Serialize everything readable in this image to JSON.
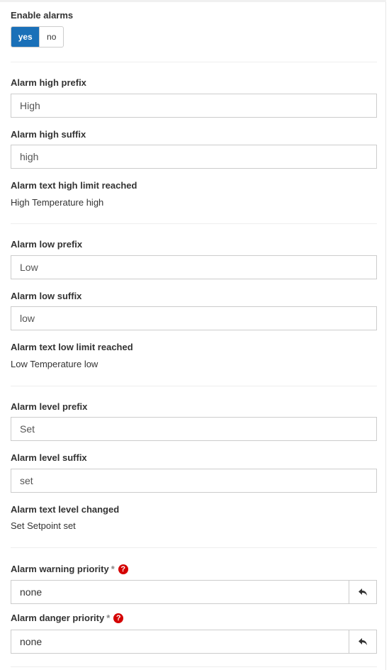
{
  "enable_alarms": {
    "label": "Enable alarms",
    "yes_label": "yes",
    "no_label": "no",
    "selected": "yes",
    "active_color": "#1a70b8"
  },
  "high": {
    "prefix_label": "Alarm high prefix",
    "prefix_value": "High",
    "suffix_label": "Alarm high suffix",
    "suffix_value": "high",
    "text_label": "Alarm text high limit reached",
    "text_value": "High Temperature high"
  },
  "low": {
    "prefix_label": "Alarm low prefix",
    "prefix_value": "Low",
    "suffix_label": "Alarm low suffix",
    "suffix_value": "low",
    "text_label": "Alarm text low limit reached",
    "text_value": "Low Temperature low"
  },
  "level": {
    "prefix_label": "Alarm level prefix",
    "prefix_value": "Set",
    "suffix_label": "Alarm level suffix",
    "suffix_value": "set",
    "text_label": "Alarm text level changed",
    "text_value": "Set Setpoint set"
  },
  "warning_priority": {
    "label": "Alarm warning priority",
    "required_mark": "*",
    "help_icon": "question-circle-icon",
    "value": "none",
    "reset_icon": "undo-arrow-icon"
  },
  "danger_priority": {
    "label": "Alarm danger priority",
    "required_mark": "*",
    "help_icon": "question-circle-icon",
    "value": "none",
    "reset_icon": "undo-arrow-icon"
  },
  "colors": {
    "help_icon": "#d40000",
    "border": "#cccccc",
    "divider": "#eeeeee"
  }
}
